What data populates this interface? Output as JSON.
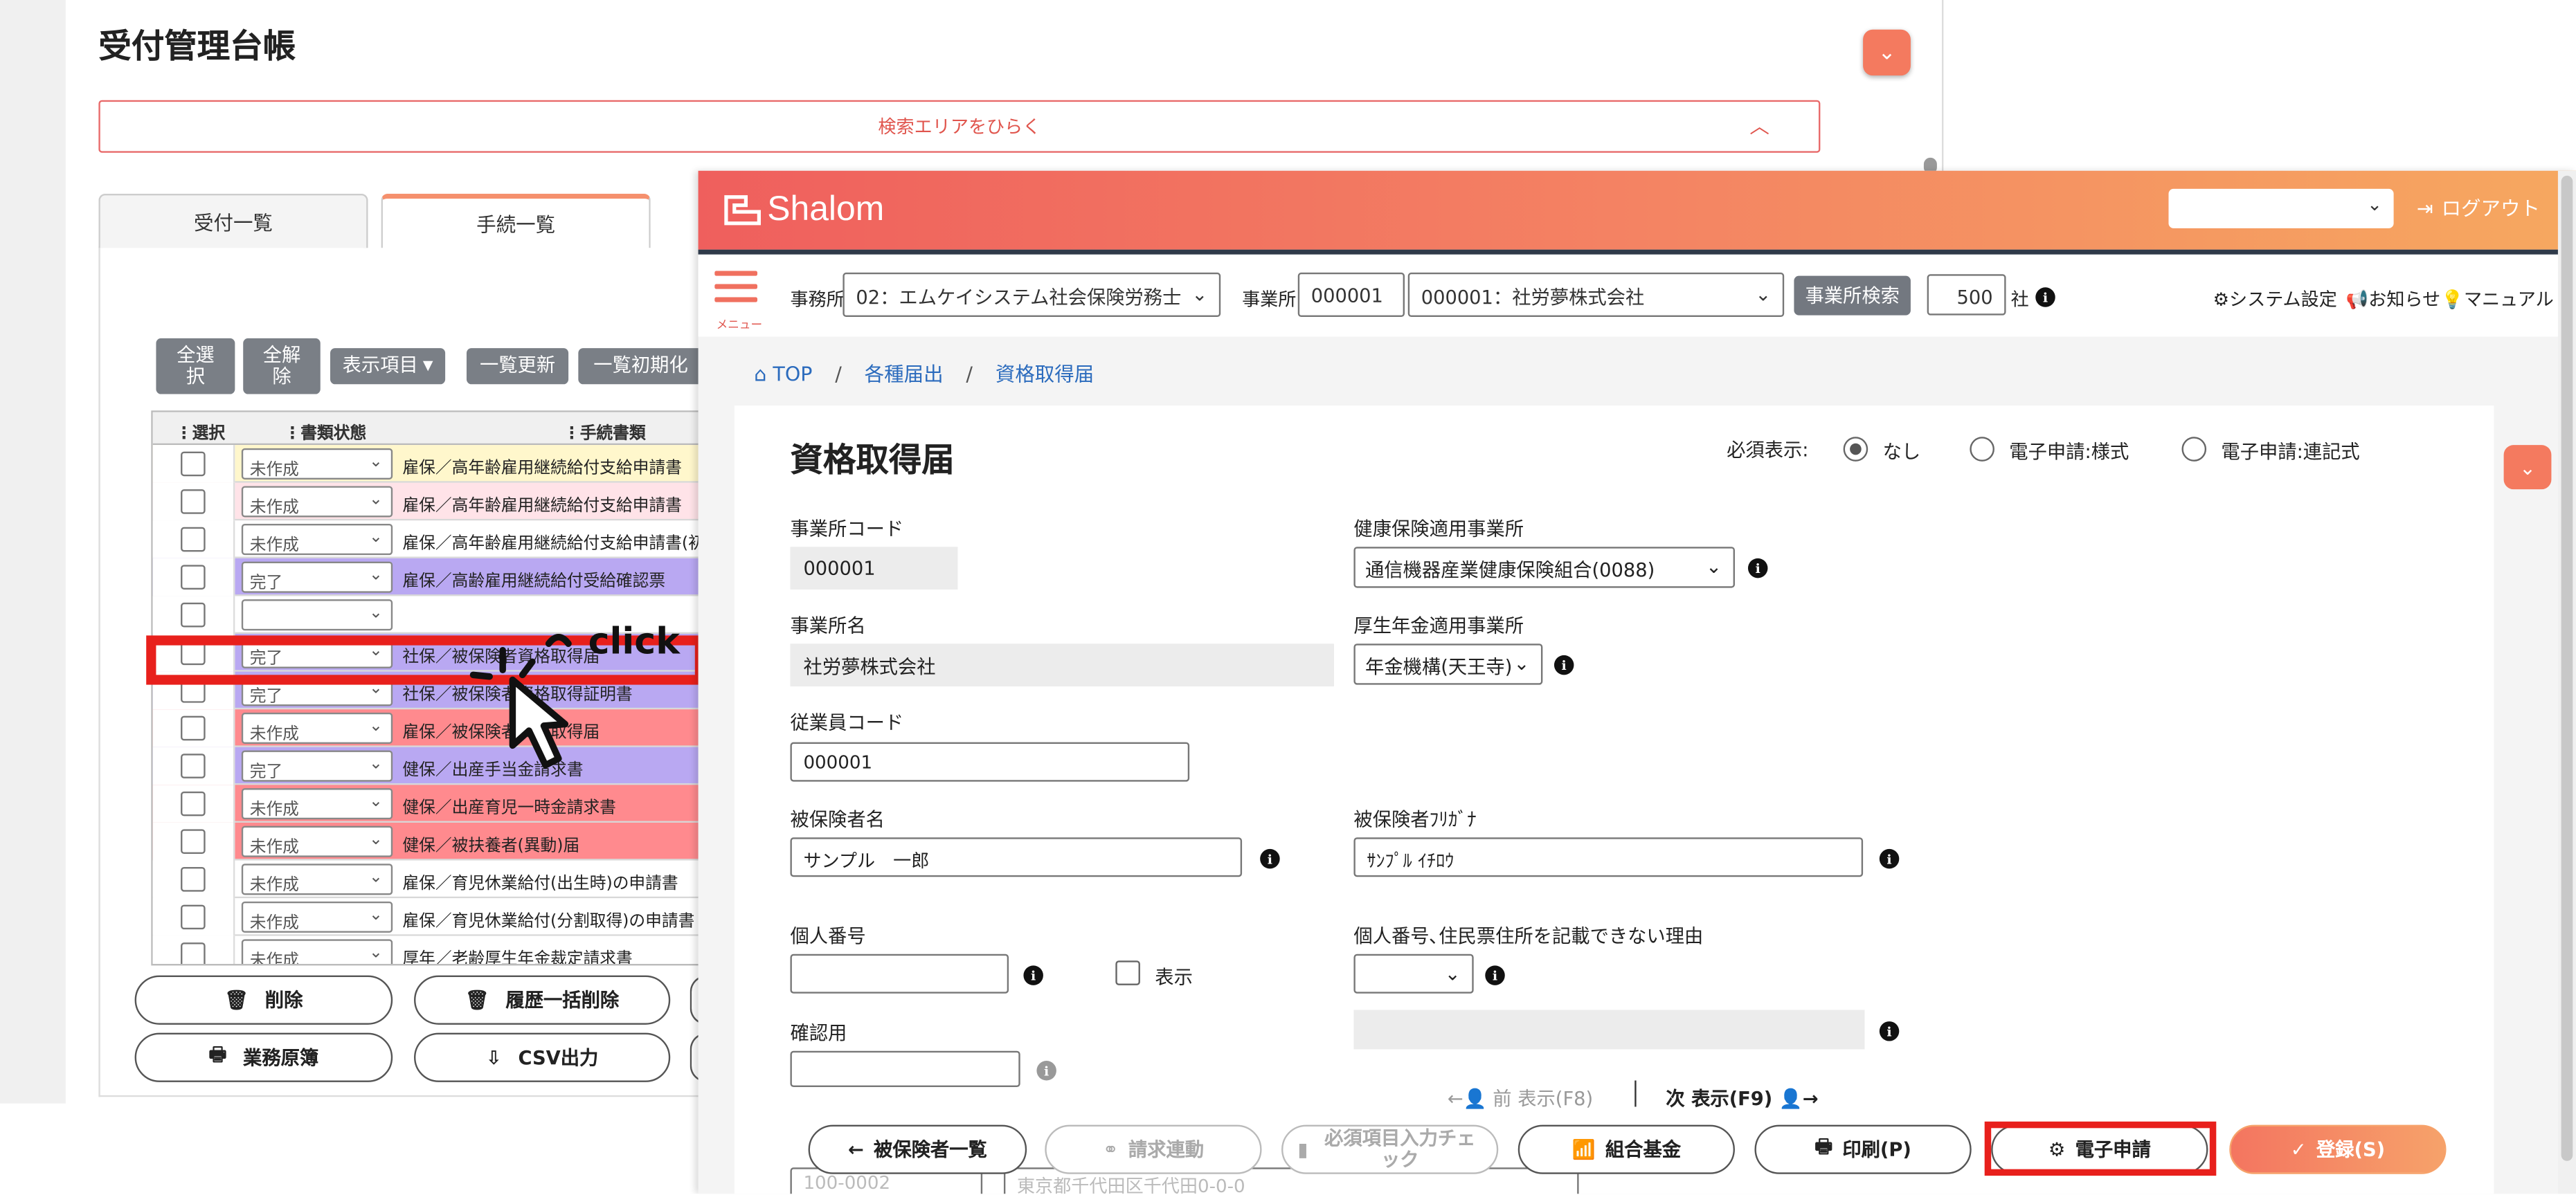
{
  "background_window": {
    "title": "受付管理台帳",
    "search_toggle": "検索エリアをひらく",
    "tabs": [
      "受付一覧",
      "手続一覧"
    ],
    "toolbar": {
      "select_all": "全選択",
      "deselect_all": "全解除",
      "display_items": "表示項目",
      "refresh": "一覧更新",
      "reset": "一覧初期化"
    },
    "grid_headers": {
      "select": "選択",
      "status": "書類状態",
      "procedure": "手続書類"
    },
    "grid_rows": [
      {
        "status": "未作成",
        "procedure": "雇保／高年齢雇用継続給付支給申請書",
        "color": "#fff7cc"
      },
      {
        "status": "未作成",
        "procedure": "雇保／高年齢雇用継続給付支給申請書",
        "color": "#ffe3e8"
      },
      {
        "status": "未作成",
        "procedure": "雇保／高年齢雇用継続給付支給申請書(初",
        "color": "#ffffff"
      },
      {
        "status": "完了",
        "procedure": "雇保／高齢雇用継続給付受給確認票",
        "color": "#b9a8f2"
      },
      {
        "status": "",
        "procedure": "",
        "color": "#ffffff"
      },
      {
        "status": "完了",
        "procedure": "社保／被保険者資格取得届",
        "color": "#b9a8f2"
      },
      {
        "status": "完了",
        "procedure": "社保／被保険者資格取得証明書",
        "color": "#b9a8f2"
      },
      {
        "status": "未作成",
        "procedure": "雇保／被保険者資格取得届",
        "color": "#ff8a8e"
      },
      {
        "status": "完了",
        "procedure": "健保／出産手当金請求書",
        "color": "#b9a8f2"
      },
      {
        "status": "未作成",
        "procedure": "健保／出産育児一時金請求書",
        "color": "#ff8a8e"
      },
      {
        "status": "未作成",
        "procedure": "健保／被扶養者(異動)届",
        "color": "#ff8a8e"
      },
      {
        "status": "未作成",
        "procedure": "雇保／育児休業給付(出生時)の申請書",
        "color": "#ffffff"
      },
      {
        "status": "未作成",
        "procedure": "雇保／育児休業給付(分割取得)の申請書",
        "color": "#ffffff"
      },
      {
        "status": "未作成",
        "procedure": "厚年／老齢厚生年金裁定請求書",
        "color": "#ffffff"
      }
    ],
    "annotation": "click",
    "bottom_buttons": {
      "delete": "削除",
      "bulk_delete": "履歴一括削除",
      "ledger": "業務原簿",
      "csv": "CSV出力"
    }
  },
  "app": {
    "logo": "Shalom",
    "logout": "ログアウト",
    "menu_label": "メニュー",
    "office_label": "事務所",
    "office_value": "02：エムケイシステム社会保険労務士",
    "site_label": "事業所",
    "site_code": "000001",
    "site_value": "000001：社労夢株式会社",
    "site_search": "事業所検索",
    "count_value": "500",
    "count_unit": "社",
    "system_settings": "システム設定",
    "notice": "お知らせ",
    "manual": "マニュアル"
  },
  "breadcrumb": [
    "TOP",
    "各種届出",
    "資格取得届"
  ],
  "form": {
    "title": "資格取得届",
    "required_label": "必須表示:",
    "required_options": [
      "なし",
      "電子申請:様式",
      "電子申請:連記式"
    ],
    "office_code_label": "事業所コード",
    "office_code": "000001",
    "health_label": "健康保険適用事業所",
    "health_value": "通信機器産業健康保険組合(0088)",
    "office_name_label": "事業所名",
    "office_name": "社労夢株式会社",
    "pension_label": "厚生年金適用事業所",
    "pension_value": "年金機構(天王寺)",
    "employee_code_label": "従業員コード",
    "employee_code": "000001",
    "insured_name_label": "被保険者名",
    "insured_name": "サンプル　一郎",
    "insured_kana_label": "被保険者ﾌﾘｶﾞﾅ",
    "insured_kana": "ｻﾝﾌﾟﾙ ｲﾁﾛｳ",
    "my_number_label": "個人番号",
    "show_label": "表示",
    "reason_label": "個人番号､住民票住所を記載できない理由",
    "confirm_label": "確認用",
    "prev": "前 表示(F8)",
    "next": "次 表示(F9)",
    "postal": "100-0002",
    "address": "東京都千代田区千代田0-0-0"
  },
  "actions": {
    "insured_list": "被保険者一覧",
    "billing": "請求連動",
    "required_check": "必須項目入力チェック",
    "union_fund": "組合基金",
    "print": "印刷(P)",
    "e_apply": "電子申請",
    "register": "登録(S)"
  }
}
